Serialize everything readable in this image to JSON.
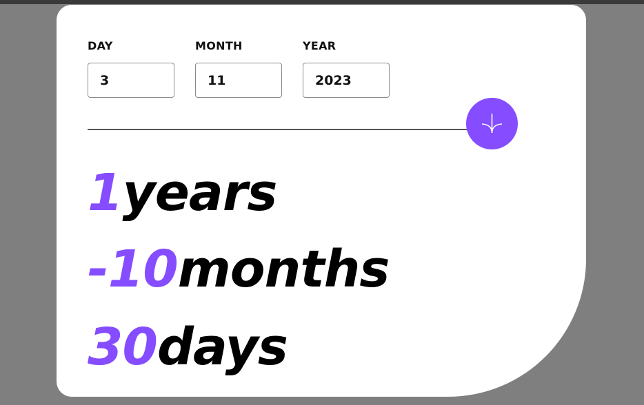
{
  "form": {
    "day": {
      "label": "DAY",
      "value": "3"
    },
    "month": {
      "label": "MONTH",
      "value": "11"
    },
    "year": {
      "label": "YEAR",
      "value": "2023"
    }
  },
  "submit": {
    "icon": "arrow-down-icon",
    "accent_color": "#854dff"
  },
  "results": {
    "years": {
      "value": "1",
      "unit": "years"
    },
    "months": {
      "value": "-10",
      "unit": "months"
    },
    "days": {
      "value": "30",
      "unit": "days"
    }
  },
  "colors": {
    "accent": "#854dff",
    "background": "#7f7f7f",
    "card": "#ffffff",
    "text": "#000000"
  }
}
